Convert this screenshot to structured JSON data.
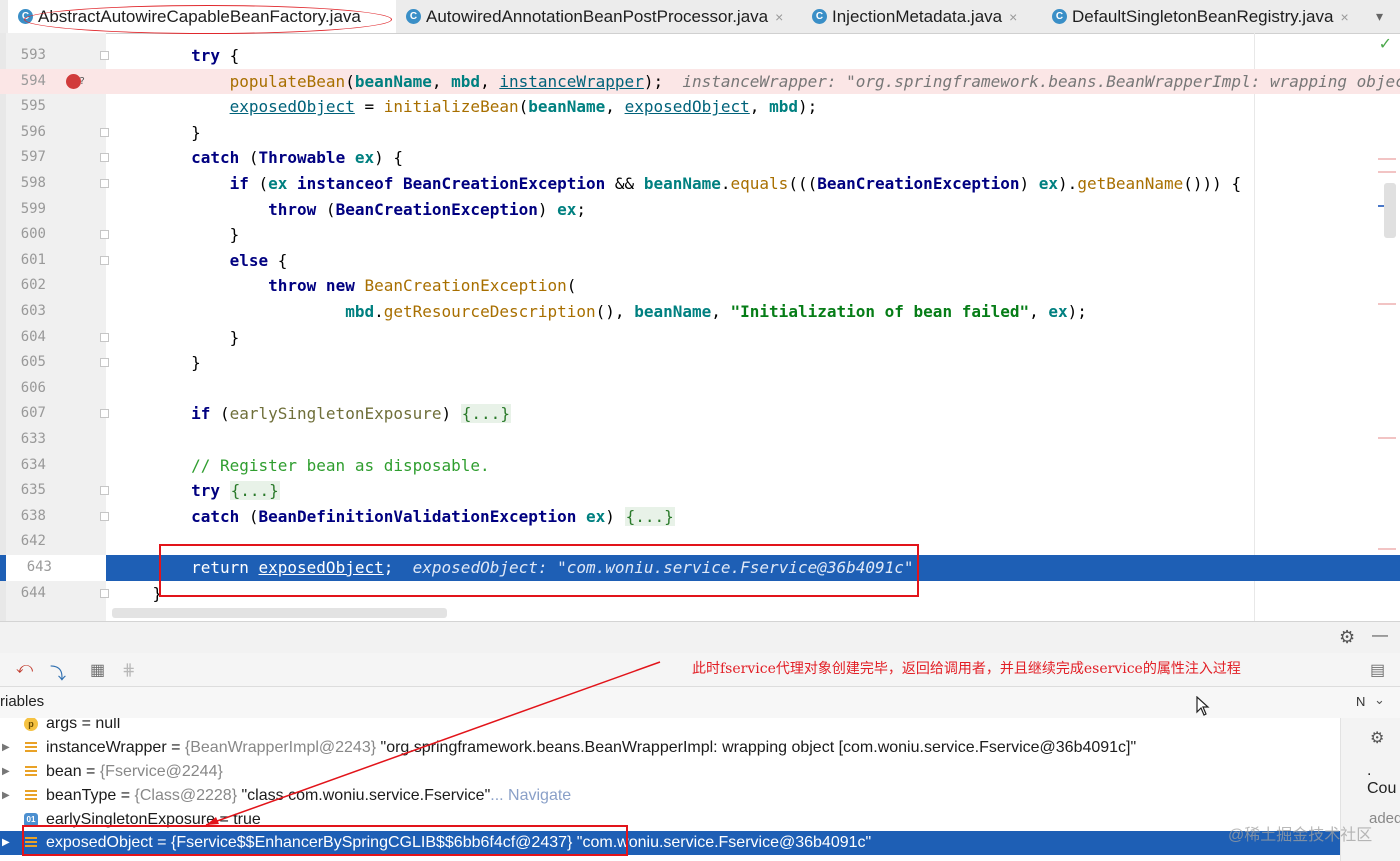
{
  "tabs": [
    {
      "label": "AbstractAutowireCapableBeanFactory.java",
      "close": ""
    },
    {
      "label": "AutowiredAnnotationBeanPostProcessor.java",
      "close": "×"
    },
    {
      "label": "InjectionMetadata.java",
      "close": "×"
    },
    {
      "label": "DefaultSingletonBeanRegistry.java",
      "close": "×"
    }
  ],
  "tab_icon_letter": "C",
  "tab_overflow": "▾",
  "check_mark": "✓",
  "line_numbers": [
    "593",
    "594",
    "595",
    "596",
    "597",
    "598",
    "599",
    "600",
    "601",
    "602",
    "603",
    "604",
    "605",
    "606",
    "607",
    "633",
    "634",
    "635",
    "638",
    "642",
    "643",
    "644"
  ],
  "code": {
    "l593_try": "try",
    "l593_brace": " {",
    "l594_method": "populateBean",
    "l594_open": "(",
    "l594_arg1": "beanName",
    "l594_sep1": ", ",
    "l594_arg2": "mbd",
    "l594_sep2": ", ",
    "l594_arg3": "instanceWrapper",
    "l594_close": ");  ",
    "l594_inline": "instanceWrapper: \"org.springframework.beans.BeanWrapperImpl: wrapping object",
    "l595_var": "exposedObject",
    "l595_eq": " = ",
    "l595_method": "initializeBean",
    "l595_open": "(",
    "l595_arg1": "beanName",
    "l595_sep1": ", ",
    "l595_arg2": "exposedObject",
    "l595_sep2": ", ",
    "l595_arg3": "mbd",
    "l595_close": ");",
    "l596": "}",
    "l597_catch": "catch",
    "l597_open": " (",
    "l597_type": "Throwable",
    "l597_space": " ",
    "l597_var": "ex",
    "l597_close": ") {",
    "l598_if": "if",
    "l598_open": " (",
    "l598_ex": "ex",
    "l598_instanceof": " instanceof ",
    "l598_type": "BeanCreationException",
    "l598_and": " && ",
    "l598_bn": "beanName",
    "l598_dot": ".",
    "l598_equals": "equals",
    "l598_p": "(((",
    "l598_type2": "BeanCreationException",
    "l598_sp": ") ",
    "l598_ex2": "ex",
    "l598_dot2": ").",
    "l598_get": "getBeanName",
    "l598_end": "())) {",
    "l599_throw": "throw",
    "l599_open": " (",
    "l599_type": "BeanCreationException",
    "l599_sp": ") ",
    "l599_ex": "ex",
    "l599_end": ";",
    "l600": "}",
    "l601_else": "else",
    "l601_brace": " {",
    "l602_throw": "throw",
    "l602_new": " new ",
    "l602_ctor": "BeanCreationException",
    "l602_open": "(",
    "l603_mbd": "mbd",
    "l603_dot": ".",
    "l603_method": "getResourceDescription",
    "l603_p": "(), ",
    "l603_bn": "beanName",
    "l603_sep": ", ",
    "l603_str": "\"Initialization of bean failed\"",
    "l603_sep2": ", ",
    "l603_ex": "ex",
    "l603_end": ");",
    "l604": "}",
    "l605": "}",
    "l607_if": "if",
    "l607_open": " (",
    "l607_var": "earlySingletonExposure",
    "l607_close": ") ",
    "l607_fold": "{...}",
    "l634_comment": "// Register bean as disposable.",
    "l635_try": "try",
    "l635_sp": " ",
    "l635_fold": "{...}",
    "l638_catch": "catch",
    "l638_open": " (",
    "l638_type": "BeanDefinitionValidationException",
    "l638_sp": " ",
    "l638_var": "ex",
    "l638_close": ") ",
    "l638_fold": "{...}",
    "l643_return": "return",
    "l643_sp": " ",
    "l643_var": "exposedObject",
    "l643_semi": ";  ",
    "l643_inline": "exposedObject: \"com.woniu.service.Fservice@36b4091c\"",
    "l644": "}"
  },
  "annotation_text": "此时fservice代理对象创建完毕，返回给调用者，并且继续完成eservice的属性注入过程",
  "debug": {
    "variables_title": "riables",
    "mode_label": "N",
    "chevron": "⌄",
    "gear": "⚙",
    "minimize": "—",
    "tools": [
      "⤺",
      "⤵",
      "▦",
      "⋕"
    ],
    "layout_icon": "▤"
  },
  "variables": [
    {
      "name": "args",
      "eq": " = ",
      "type": "",
      "value": "null",
      "nav": "",
      "icon": "p",
      "icon_label": "p",
      "expandable": false
    },
    {
      "name": "instanceWrapper",
      "eq": " = ",
      "type": "{BeanWrapperImpl@2243}",
      "value": " \"org.springframework.beans.BeanWrapperImpl: wrapping object [com.woniu.service.Fservice@36b4091c]\"",
      "nav": "",
      "icon": "lines",
      "icon_label": "",
      "expandable": true
    },
    {
      "name": "bean",
      "eq": " = ",
      "type": "{Fservice@2244}",
      "value": "",
      "nav": "",
      "icon": "lines",
      "icon_label": "",
      "expandable": true
    },
    {
      "name": "beanType",
      "eq": " = ",
      "type": "{Class@2228}",
      "value": " \"class com.woniu.service.Fservice\"",
      "nav": "... Navigate",
      "icon": "lines",
      "icon_label": "",
      "expandable": true
    },
    {
      "name": "earlySingletonExposure",
      "eq": " = ",
      "type": "",
      "value": "true",
      "nav": "",
      "icon": "o1",
      "icon_label": "01",
      "expandable": false
    },
    {
      "name": "exposedObject",
      "eq": " = ",
      "type": "{Fservice$$EnhancerBySpringCGLIB$$6bb6f4cf@2437}",
      "value": " \"com.woniu.service.Fservice@36b4091c\"",
      "nav": "",
      "icon": "lines",
      "icon_label": "",
      "expandable": true
    }
  ],
  "right_panel": {
    "cou": ". Cou",
    "loaded": "aded."
  },
  "watermark": "@稀土掘金技术社区",
  "colors": {
    "accent_blue": "#1e5fb5",
    "annotation_red": "#e2141a"
  }
}
